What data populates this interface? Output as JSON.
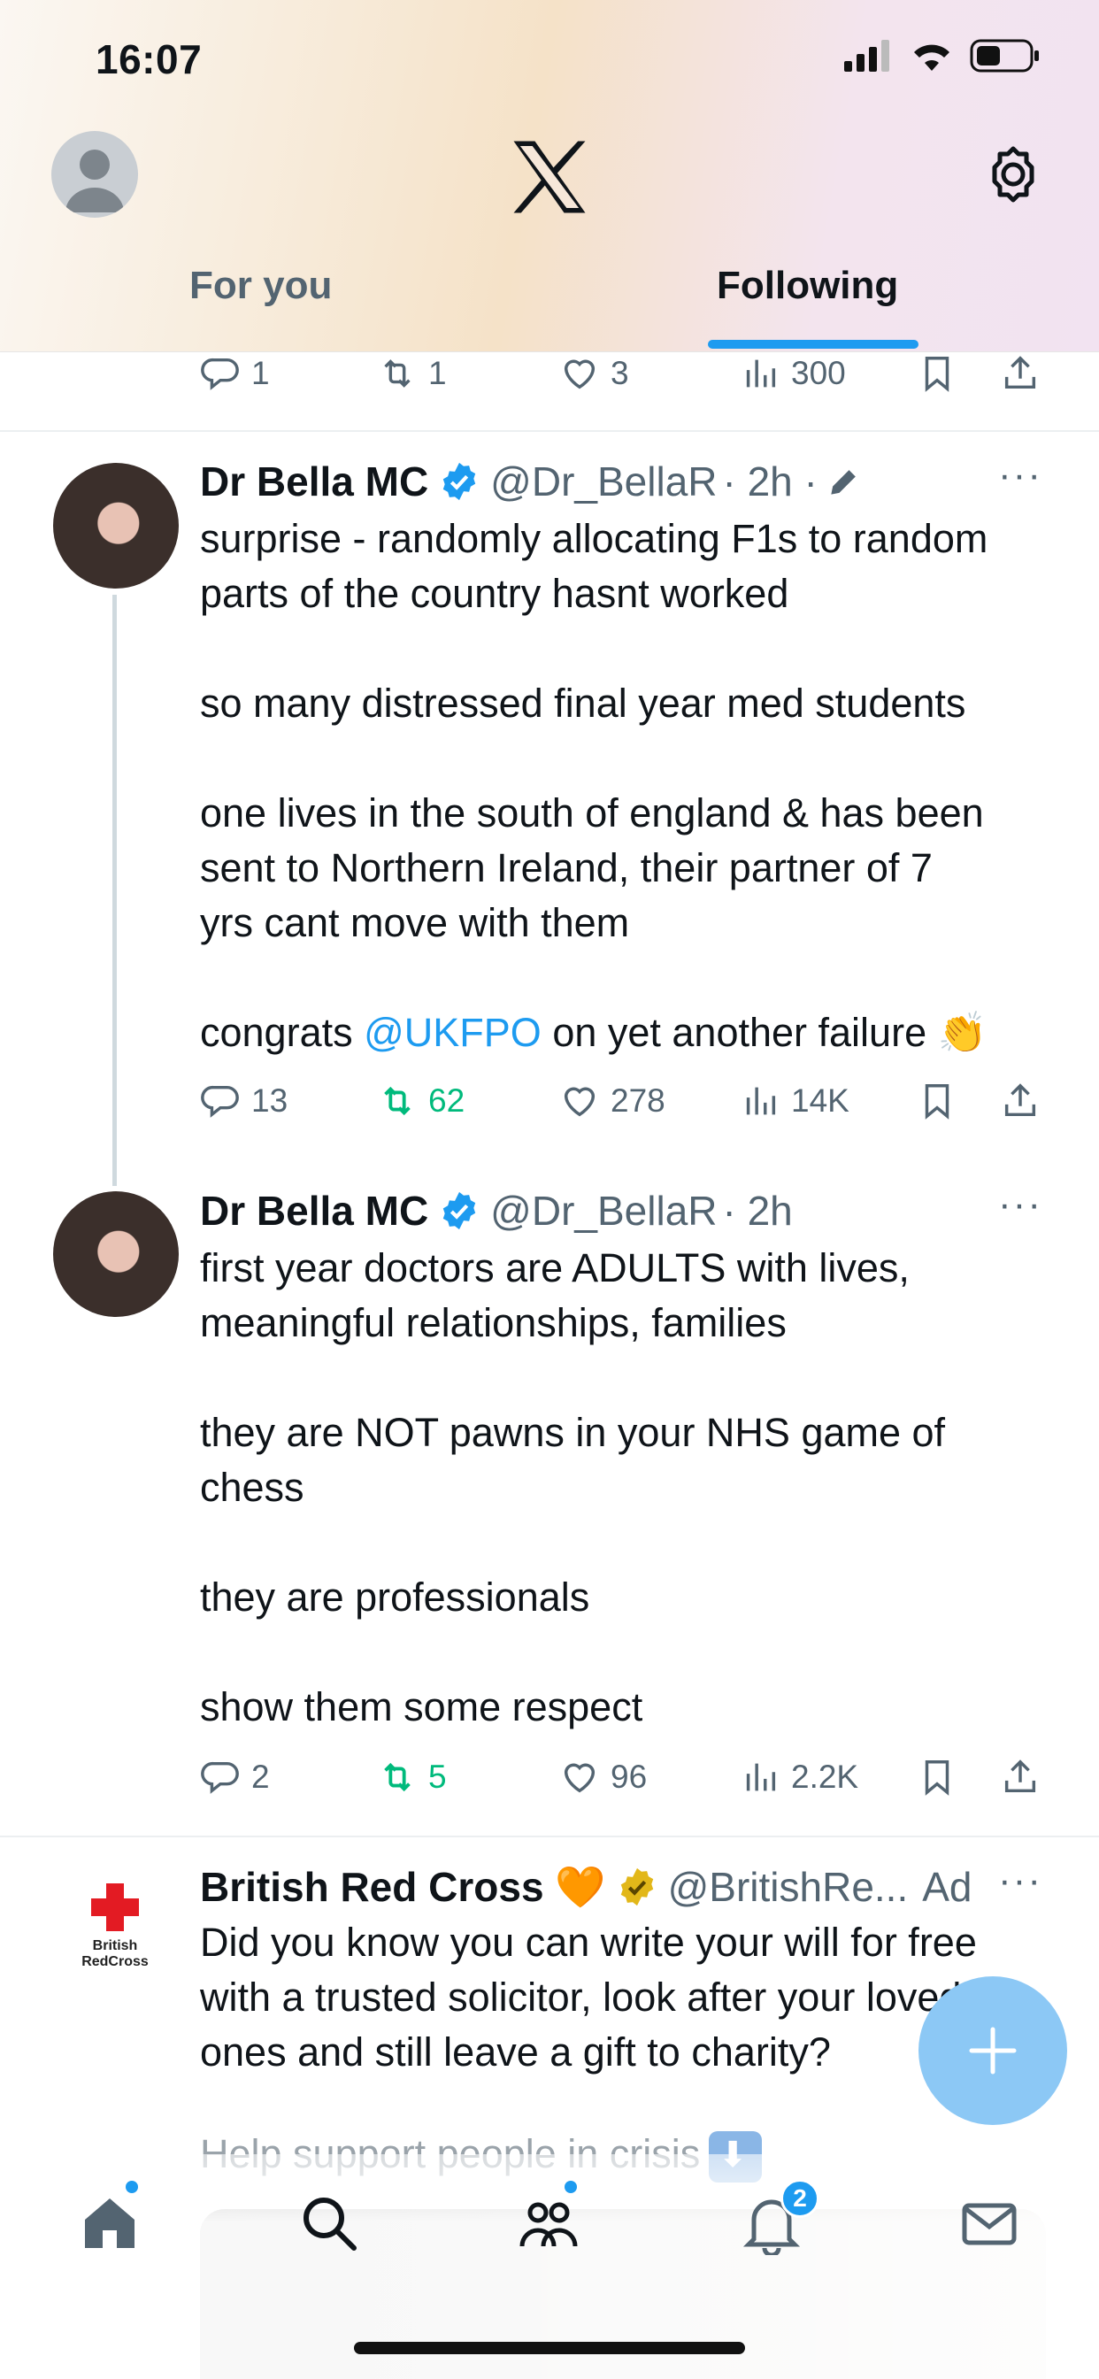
{
  "status_bar": {
    "time": "16:07"
  },
  "header": {
    "tabs": [
      {
        "label": "For you",
        "active": false
      },
      {
        "label": "Following",
        "active": true
      }
    ]
  },
  "prev_tweet_actions": {
    "replies": "1",
    "retweets": "1",
    "likes": "3",
    "views": "300"
  },
  "tweets": [
    {
      "name": "Dr Bella MC",
      "handle": "@Dr_BellaR",
      "time": "· 2h ·",
      "text_before_mention": "surprise - randomly allocating F1s to random\nparts of the country hasnt worked\n\nso many distressed final year med students\n\none lives in the south of england & has been\nsent to Northern Ireland, their partner of 7\nyrs cant move with them\n\ncongrats ",
      "mention": "@UKFPO",
      "text_after_mention": " on yet another failure 👏",
      "replies": "13",
      "retweets": "62",
      "likes": "278",
      "views": "14K"
    },
    {
      "name": "Dr Bella MC",
      "handle": "@Dr_BellaR",
      "time": "· 2h",
      "text": "first year doctors are ADULTS with lives,\nmeaningful relationships, families\n\nthey are NOT pawns in your NHS game of\nchess\n\nthey are professionals\n\nshow them some respect",
      "replies": "2",
      "retweets": "5",
      "likes": "96",
      "views": "2.2K"
    },
    {
      "name": "British Red Cross 🧡",
      "handle": "@BritishRe...",
      "ad_label": "Ad",
      "logo_text": "British\nRedCross",
      "text": "Did you know you can write your will for free\nwith a trusted solicitor, look after your loved\nones and still leave a gift to charity?",
      "faded_line": "Help support people in crisis"
    }
  ],
  "bottom_nav": {
    "notifications_count": "2"
  },
  "colors": {
    "accent": "#1d9bf0",
    "retweet_green": "#00ba7c",
    "muted": "#536471"
  }
}
